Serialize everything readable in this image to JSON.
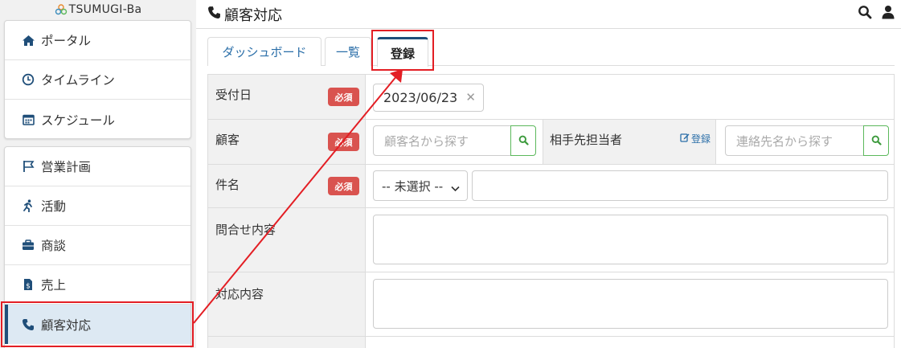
{
  "logo": {
    "text": "TSUMUGI-Ba"
  },
  "header": {
    "title": "顧客対応"
  },
  "sidebar": {
    "group1": [
      {
        "label": "ポータル",
        "icon": "home-icon"
      },
      {
        "label": "タイムライン",
        "icon": "clock-icon"
      },
      {
        "label": "スケジュール",
        "icon": "calendar-icon"
      }
    ],
    "group2": [
      {
        "label": "営業計画",
        "icon": "flag-icon"
      },
      {
        "label": "活動",
        "icon": "running-icon"
      },
      {
        "label": "商談",
        "icon": "briefcase-icon"
      },
      {
        "label": "売上",
        "icon": "invoice-icon"
      },
      {
        "label": "顧客対応",
        "icon": "phone-icon",
        "active": true
      }
    ]
  },
  "tabs": [
    {
      "label": "ダッシュボード"
    },
    {
      "label": "一覧"
    },
    {
      "label": "登録",
      "active": true
    }
  ],
  "form": {
    "required_badge": "必須",
    "date": {
      "label": "受付日",
      "value": "2023/06/23"
    },
    "customer": {
      "label": "顧客",
      "placeholder": "顧客名から探す"
    },
    "contact": {
      "label": "相手先担当者",
      "register": "登録",
      "placeholder": "連絡先名から探す"
    },
    "subject": {
      "label": "件名",
      "select_value": "-- 未選択 --"
    },
    "inquiry": {
      "label": "問合せ内容"
    },
    "response": {
      "label": "対応内容"
    }
  },
  "colors": {
    "accent": "#1f4e79",
    "required": "#d9534f",
    "search_border": "#5cb85c",
    "annotation": "#e31e24",
    "link": "#2a6ea8"
  }
}
